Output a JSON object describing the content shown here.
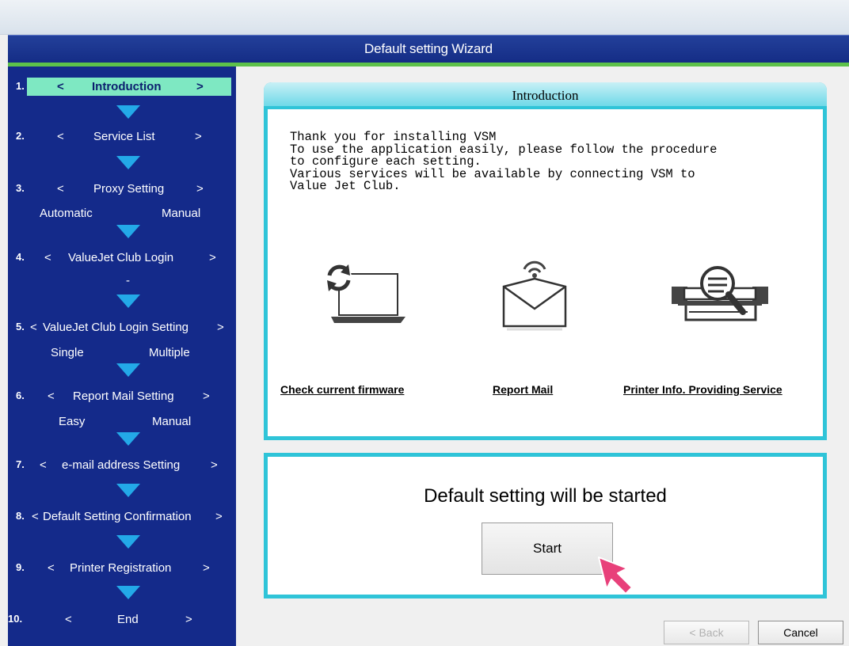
{
  "window": {
    "title": "Default setting Wizard"
  },
  "sidebar": {
    "steps": [
      {
        "num": "1.",
        "label": "Introduction",
        "active": true
      },
      {
        "num": "2.",
        "label": "Service List"
      },
      {
        "num": "3.",
        "label": "Proxy Setting",
        "options": [
          "Automatic",
          "Manual"
        ]
      },
      {
        "num": "4.",
        "label": "ValueJet Club Login",
        "options": [
          "-"
        ]
      },
      {
        "num": "5.",
        "label": "ValueJet Club Login Setting",
        "options": [
          "Single",
          "Multiple"
        ]
      },
      {
        "num": "6.",
        "label": "Report Mail Setting",
        "options": [
          "Easy",
          "Manual"
        ]
      },
      {
        "num": "7.",
        "label": "e-mail address Setting"
      },
      {
        "num": "8.",
        "label": "Default Setting Confirmation"
      },
      {
        "num": "9.",
        "label": "Printer Registration"
      },
      {
        "num": "10.",
        "label": "End"
      }
    ],
    "prev_symbol": "<",
    "next_symbol": ">"
  },
  "intro": {
    "title": "Introduction",
    "text": "Thank you for installing VSM\nTo use the application easily, please follow the procedure\nto configure each setting.\nVarious services will be available by connecting VSM to\nValue Jet Club.",
    "features": [
      {
        "label": "Check current firmware",
        "icon": "firmware-update-icon"
      },
      {
        "label": "Report Mail",
        "icon": "mail-icon"
      },
      {
        "label": "Printer Info. Providing Service",
        "icon": "printer-search-icon"
      }
    ]
  },
  "start": {
    "message": "Default setting will be started",
    "button_label": "Start"
  },
  "footer": {
    "back_label": "< Back",
    "cancel_label": "Cancel"
  },
  "colors": {
    "sidebar_bg": "#142a8a",
    "active_step": "#7ee8c2",
    "arrow": "#23a9e8",
    "panel_border": "#2fc4d8",
    "title_bar": "#1a3590",
    "accent_green": "#5dc14a",
    "cursor": "#e8407a"
  }
}
